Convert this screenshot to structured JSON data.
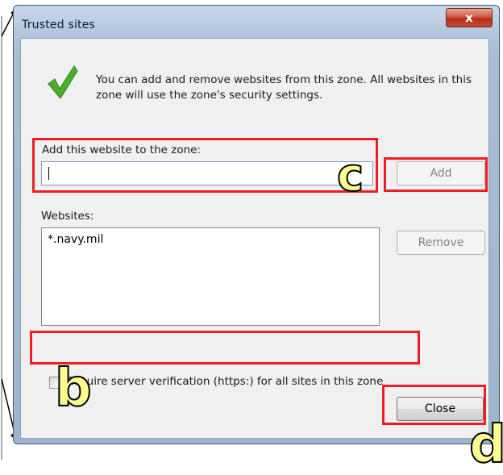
{
  "window": {
    "title": "Trusted sites",
    "close_glyph": "x"
  },
  "intro": {
    "icon": "green-checkmark-icon",
    "text": "You can add and remove websites from this zone. All websites in this zone will use the zone's security settings."
  },
  "add_section": {
    "label": "Add this website to the zone:",
    "input_value": "",
    "add_button": "Add"
  },
  "websites": {
    "label": "Websites:",
    "items": [
      "*.navy.mil"
    ],
    "remove_button": "Remove"
  },
  "https_option": {
    "label": "Require server verification (https:) for all sites in this zone",
    "checked": false
  },
  "close_button": "Close",
  "annotations": {
    "b": "b",
    "c": "c",
    "d": "d"
  },
  "colors": {
    "annotation_red": "#ee1c24",
    "annotation_letter_fill": "#fffc8f",
    "checkmark_green": "#4caf2a"
  }
}
